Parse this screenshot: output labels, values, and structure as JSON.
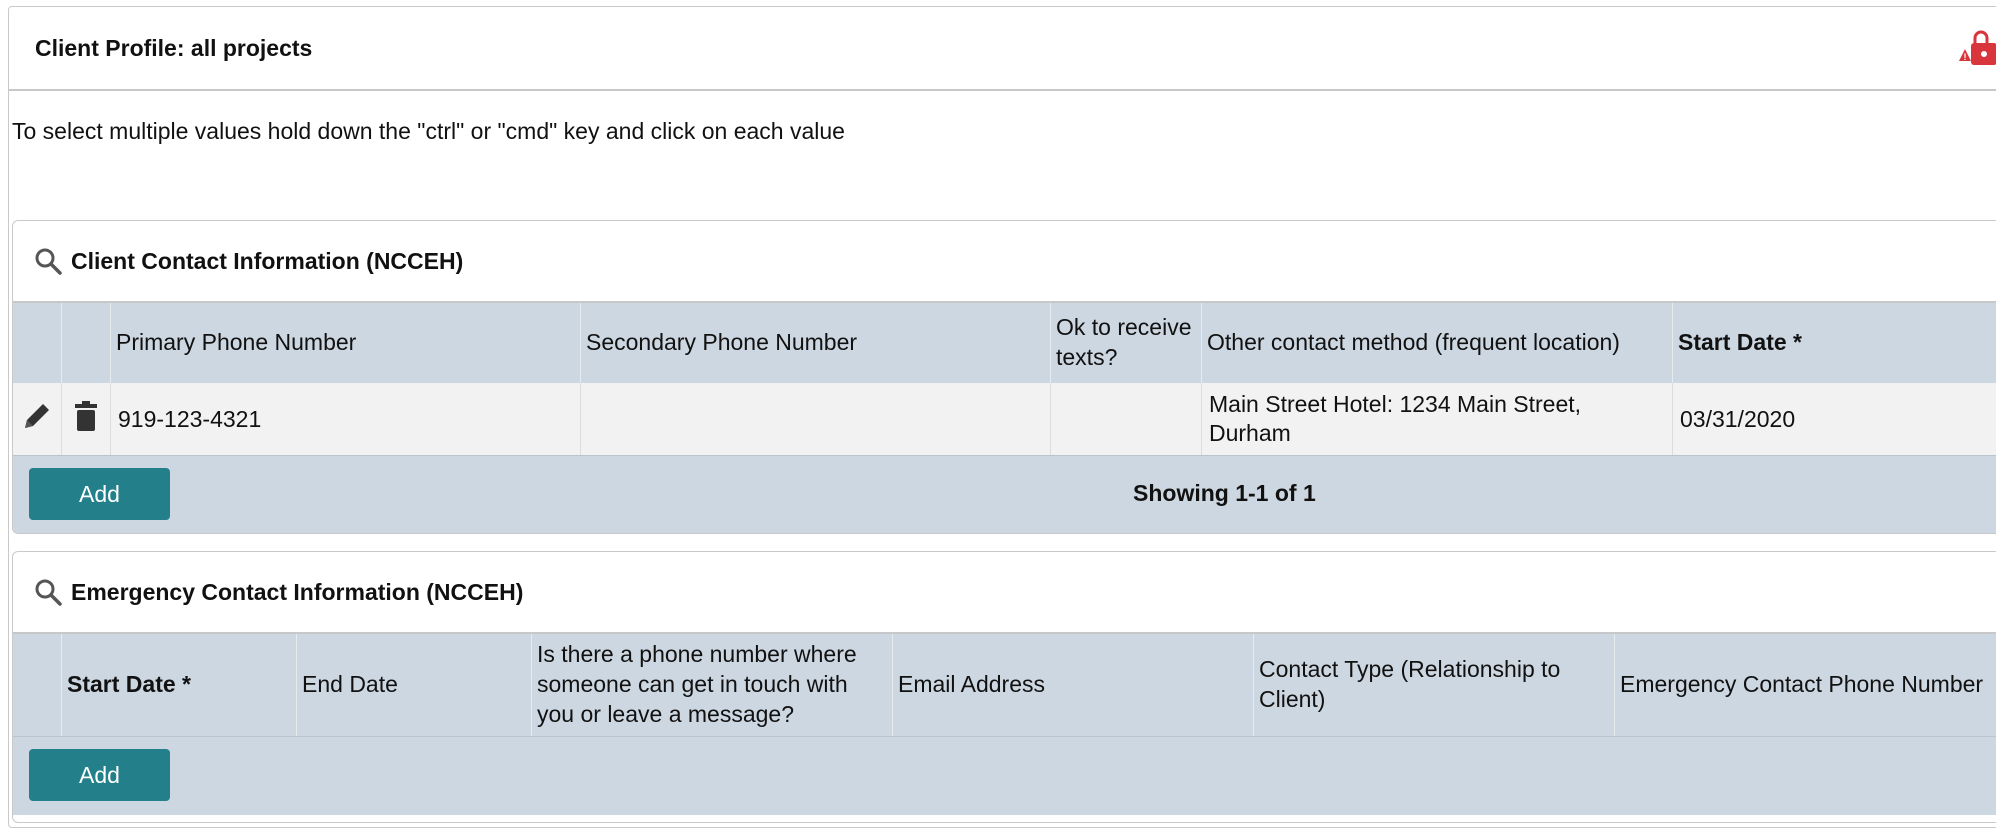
{
  "panel": {
    "title": "Client Profile: all projects"
  },
  "instructions": "To select multiple values hold down the \"ctrl\" or \"cmd\" key and click on each value",
  "contact_section": {
    "title": "Client Contact Information (NCCEH)",
    "columns": [
      "Primary Phone Number",
      "Secondary Phone Number",
      "Ok to receive texts?",
      "Other contact method (frequent location)",
      "Start Date *"
    ],
    "rows": [
      {
        "primary_phone": "919-123-4321",
        "secondary_phone": "",
        "ok_texts": "",
        "other_contact": "Main Street Hotel: 1234 Main Street, Durham",
        "start_date": "03/31/2020"
      }
    ],
    "add_label": "Add",
    "showing": "Showing 1-1 of 1"
  },
  "emergency_section": {
    "title": "Emergency Contact Information (NCCEH)",
    "columns": [
      "Start Date *",
      "End Date",
      "Is there a phone number where someone can get in touch with you or leave a message?",
      "Email Address",
      "Contact Type (Relationship to Client)",
      "Emergency Contact Phone Number"
    ],
    "add_label": "Add"
  },
  "icons": {
    "lock": "lock-alert-icon",
    "search": "search-icon",
    "edit": "pencil-icon",
    "delete": "trash-icon"
  },
  "colors": {
    "accent": "#23808a",
    "table_header": "#cdd7e1",
    "lock_red": "#d9353c"
  }
}
